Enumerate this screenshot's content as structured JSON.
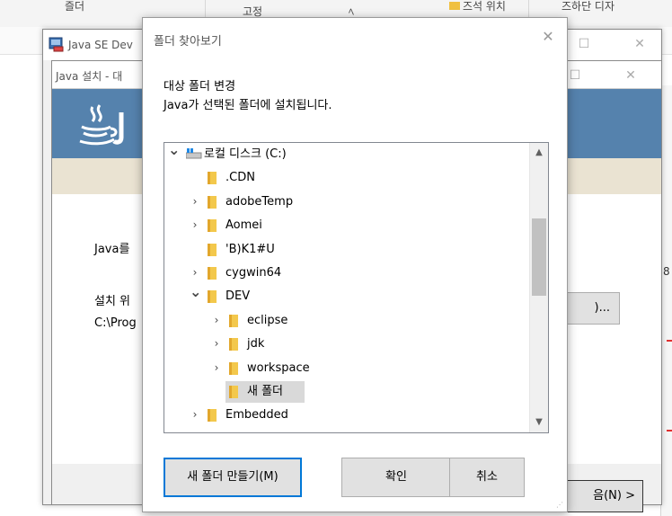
{
  "background": {
    "top_fragments": [
      "즐더",
      "고정",
      "ﾍ",
      "즈석 위치",
      "즈하단 디자"
    ],
    "java_se_window": {
      "title": "Java SE Dev"
    },
    "java_installer": {
      "title": "Java 설치 - 대",
      "label_java": "Java를",
      "label_install": "설치 위",
      "path_text": "C:\\Prog",
      "change_button": ")...",
      "next_button": "음(N) >"
    },
    "right_edge_char": "8"
  },
  "dialog": {
    "title": "폴더 찾아보기",
    "instruction_line1": "대상 폴더 변경",
    "instruction_line2": "Java가 선택된 폴더에 설치됩니다.",
    "tree": [
      {
        "label": "로컬 디스크 (C:)",
        "level": 0,
        "expander": "expanded",
        "type": "drive"
      },
      {
        "label": ".CDN",
        "level": 1,
        "expander": "none",
        "type": "folder"
      },
      {
        "label": "adobeTemp",
        "level": 1,
        "expander": "collapsed",
        "type": "folder"
      },
      {
        "label": "Aomei",
        "level": 1,
        "expander": "collapsed",
        "type": "folder"
      },
      {
        "label": "'B)K1#U",
        "level": 1,
        "expander": "none",
        "type": "folder"
      },
      {
        "label": "cygwin64",
        "level": 1,
        "expander": "collapsed",
        "type": "folder"
      },
      {
        "label": "DEV",
        "level": 1,
        "expander": "expanded",
        "type": "folder"
      },
      {
        "label": "eclipse",
        "level": 2,
        "expander": "collapsed",
        "type": "folder"
      },
      {
        "label": "jdk",
        "level": 2,
        "expander": "collapsed",
        "type": "folder"
      },
      {
        "label": "workspace",
        "level": 2,
        "expander": "collapsed",
        "type": "folder"
      },
      {
        "label": "새 폴더",
        "level": 2,
        "expander": "none",
        "type": "folder",
        "selected": true
      },
      {
        "label": "Embedded",
        "level": 1,
        "expander": "collapsed",
        "type": "folder"
      }
    ],
    "buttons": {
      "new_folder": "새 폴더 만들기(M)",
      "ok": "확인",
      "cancel": "취소"
    }
  },
  "colors": {
    "folder_yellow": "#f3c84c",
    "java_banner": "#5582ad",
    "selection": "#d9d9d9",
    "primary_border": "#0078d7"
  }
}
